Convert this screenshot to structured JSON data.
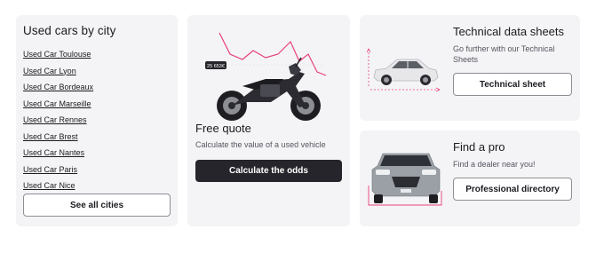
{
  "cities_card": {
    "title": "Used cars by city",
    "links": [
      "Used Car Toulouse",
      "Used Car Lyon",
      "Used Car Bordeaux",
      "Used Car Marseille",
      "Used Car Rennes",
      "Used Car Brest",
      "Used Car Nantes",
      "Used Car Paris",
      "Used Car Nice"
    ],
    "button_label": "See all cities"
  },
  "quote_card": {
    "title": "Free quote",
    "description": "Calculate the value of a used vehicle",
    "button_label": "Calculate the odds",
    "price_tag": "25 653€",
    "illustration": "motorcycle-with-price-graph"
  },
  "tech_card": {
    "title": "Technical data sheets",
    "description": "Go further with our Technical Sheets",
    "button_label": "Technical sheet",
    "illustration": "car-side-view-with-dimensions"
  },
  "pro_card": {
    "title": "Find a pro",
    "description": "Find a dealer near you!",
    "button_label": "Professional directory",
    "illustration": "car-front-view"
  },
  "colors": {
    "card_bg": "#f4f4f6",
    "primary_button": "#25252b",
    "accent": "#e8407a",
    "text": "#1b1b20"
  }
}
